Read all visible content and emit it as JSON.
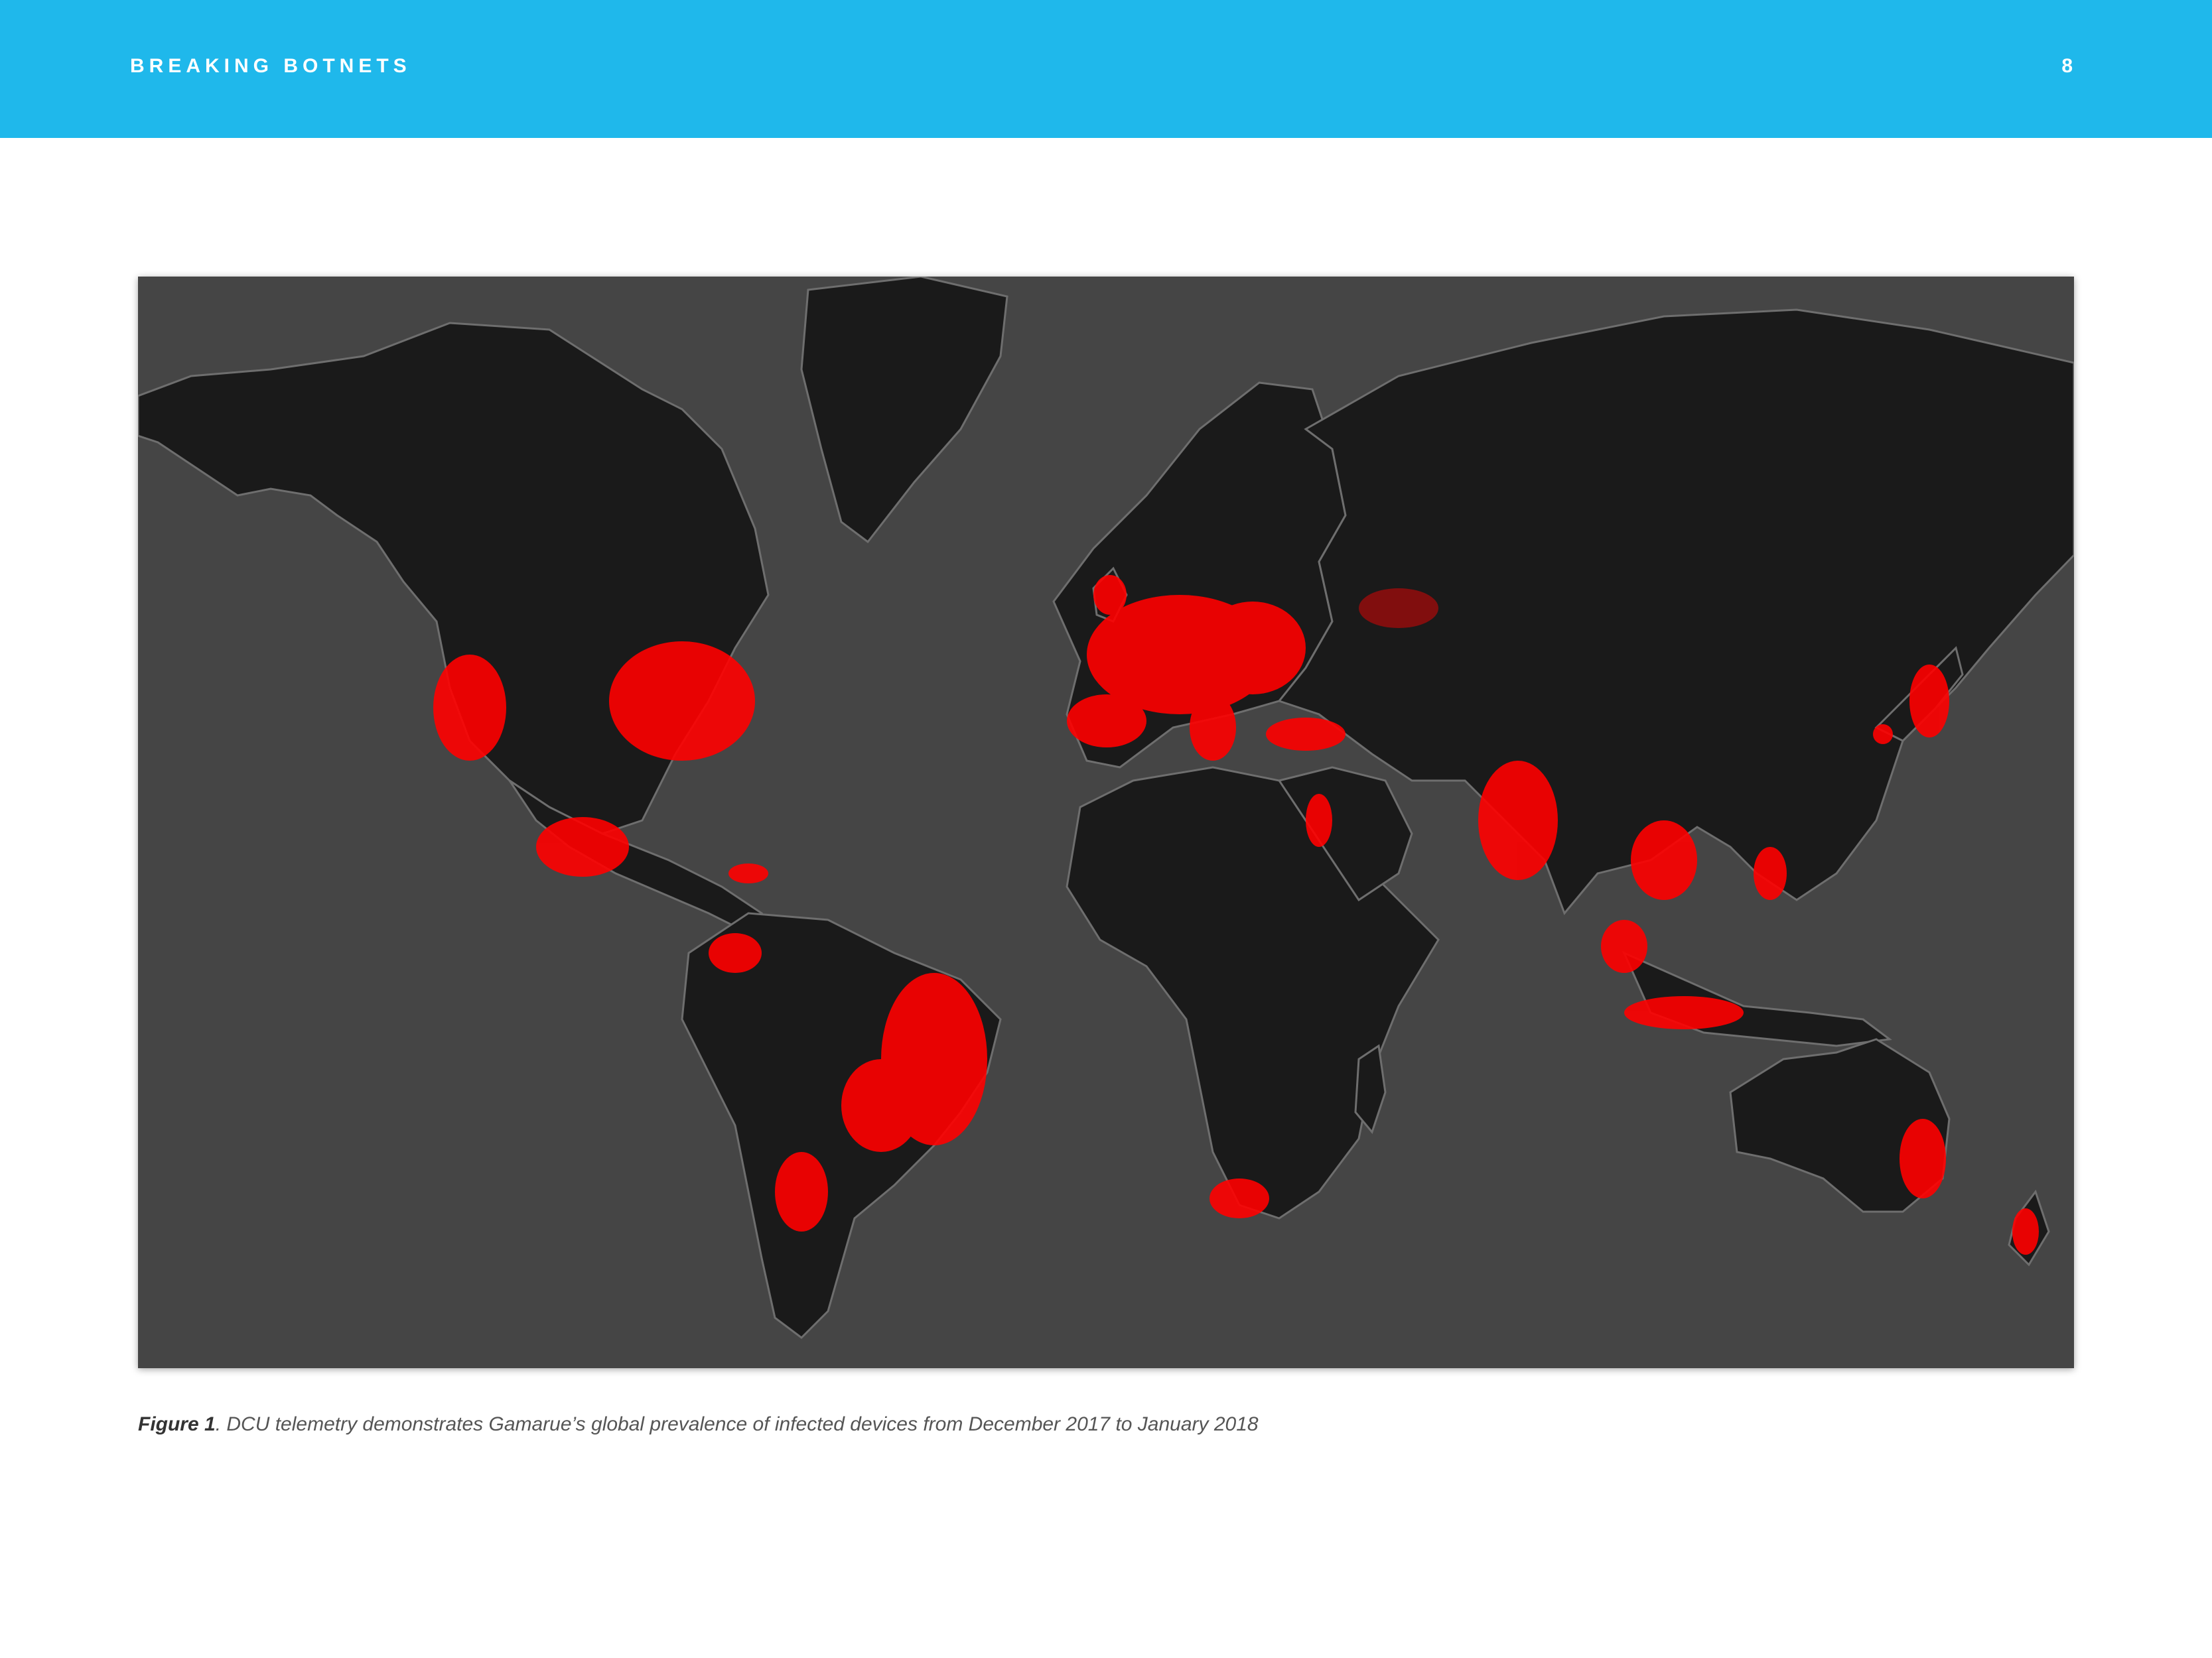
{
  "header": {
    "title": "BREAKING BOTNETS",
    "page_number": "8"
  },
  "map": {
    "ocean_color": "#454545",
    "land_color": "#1a1a1a",
    "border_color": "#6e6e6e",
    "infection_color": "#ff0000"
  },
  "caption": {
    "label": "Figure 1",
    "text": ". DCU telemetry demonstrates Gamarue’s global prevalence of infected devices from December 2017 to January 2018"
  }
}
